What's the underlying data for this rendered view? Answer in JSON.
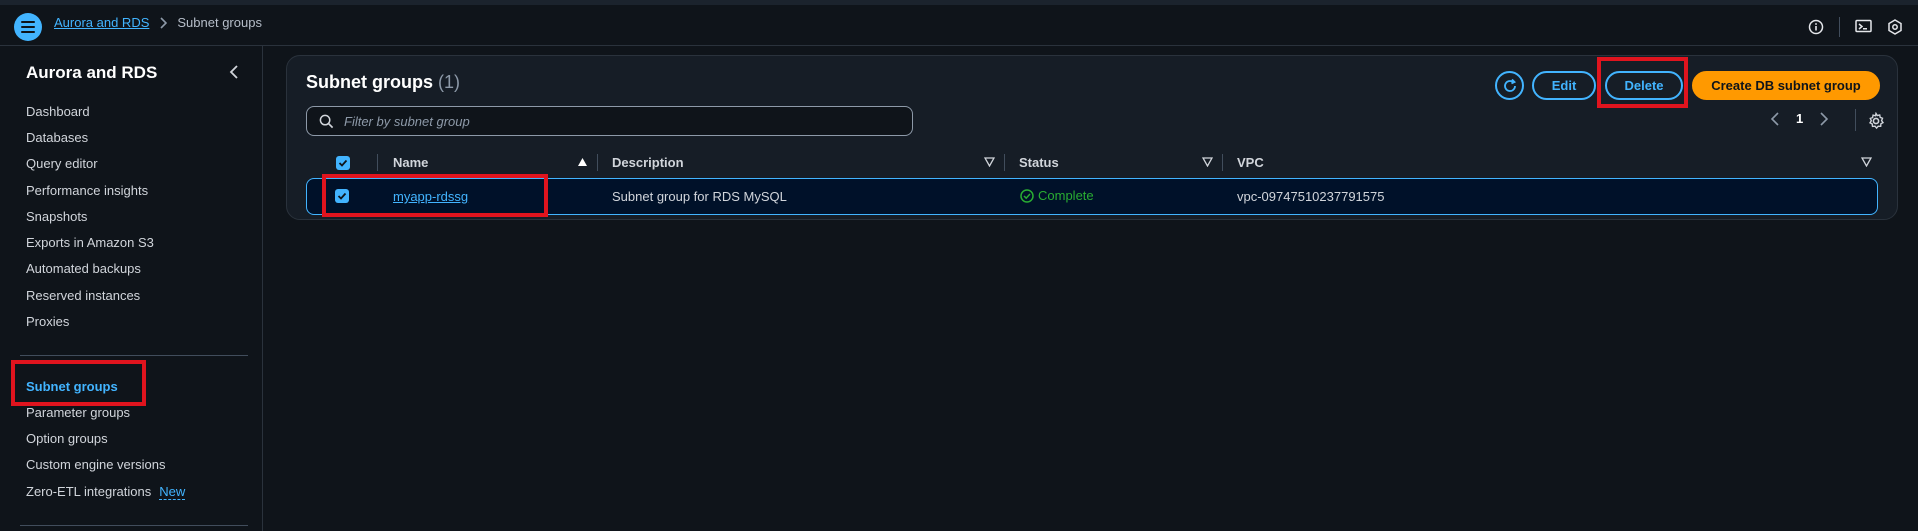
{
  "breadcrumb": {
    "root": "Aurora and RDS",
    "current": "Subnet groups"
  },
  "sidebar": {
    "title": "Aurora and RDS",
    "items": [
      {
        "label": "Dashboard"
      },
      {
        "label": "Databases"
      },
      {
        "label": "Query editor"
      },
      {
        "label": "Performance insights"
      },
      {
        "label": "Snapshots"
      },
      {
        "label": "Exports in Amazon S3"
      },
      {
        "label": "Automated backups"
      },
      {
        "label": "Reserved instances"
      },
      {
        "label": "Proxies"
      },
      {
        "label": "Subnet groups",
        "active": true
      },
      {
        "label": "Parameter groups"
      },
      {
        "label": "Option groups"
      },
      {
        "label": "Custom engine versions"
      },
      {
        "label": "Zero-ETL integrations",
        "badge": "New"
      }
    ]
  },
  "panel": {
    "title": "Subnet groups",
    "count": "(1)",
    "buttons": {
      "edit": "Edit",
      "delete": "Delete",
      "create": "Create DB subnet group"
    },
    "search_placeholder": "Filter by subnet group",
    "pagination": {
      "current_page": "1"
    }
  },
  "table": {
    "columns": [
      "Name",
      "Description",
      "Status",
      "VPC"
    ],
    "rows": [
      {
        "selected": true,
        "name": "myapp-rdssg",
        "description": "Subnet group for RDS MySQL",
        "status": "Complete",
        "vpc": "vpc-09747510237791575"
      }
    ]
  },
  "colors": {
    "accent": "#42b4ff",
    "primary_button": "#ff9900",
    "success": "#29ad32",
    "highlight": "#e0141e"
  },
  "icons": [
    "menu-icon",
    "chevron-right-icon",
    "info-icon",
    "cloudshell-icon",
    "settings-hex-icon",
    "chevron-left-icon",
    "refresh-icon",
    "search-icon",
    "gear-icon",
    "sort-up-icon",
    "sort-down-icon",
    "check-circle-icon",
    "checkbox-checked-icon"
  ]
}
